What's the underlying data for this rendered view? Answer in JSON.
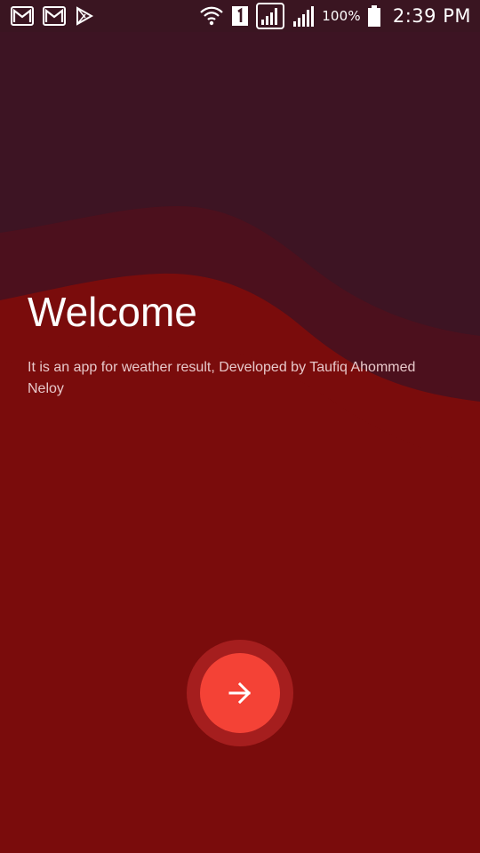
{
  "status_bar": {
    "left_icons": [
      "gmail-icon",
      "gmail-icon",
      "play-store-icon"
    ],
    "right_icons": [
      "wifi-icon",
      "sim-1-icon",
      "signal-icon",
      "signal-icon",
      "battery-icon"
    ],
    "battery_level": "100%",
    "time": "2:39 PM"
  },
  "welcome": {
    "title": "Welcome",
    "description": "It is an app for weather result, Developed by Taufiq Ahommed Neloy"
  },
  "next_button": {
    "icon": "arrow-right-icon"
  },
  "colors": {
    "status_bar": "#3a1521",
    "top_background": "#3d1423",
    "middle_wave": "#4c101d",
    "main_background": "#7a0c0c",
    "button_outer": "#a51e1e",
    "button_inner": "#f44236",
    "text_primary": "#ffffff",
    "text_secondary": "#e7c8ca"
  }
}
